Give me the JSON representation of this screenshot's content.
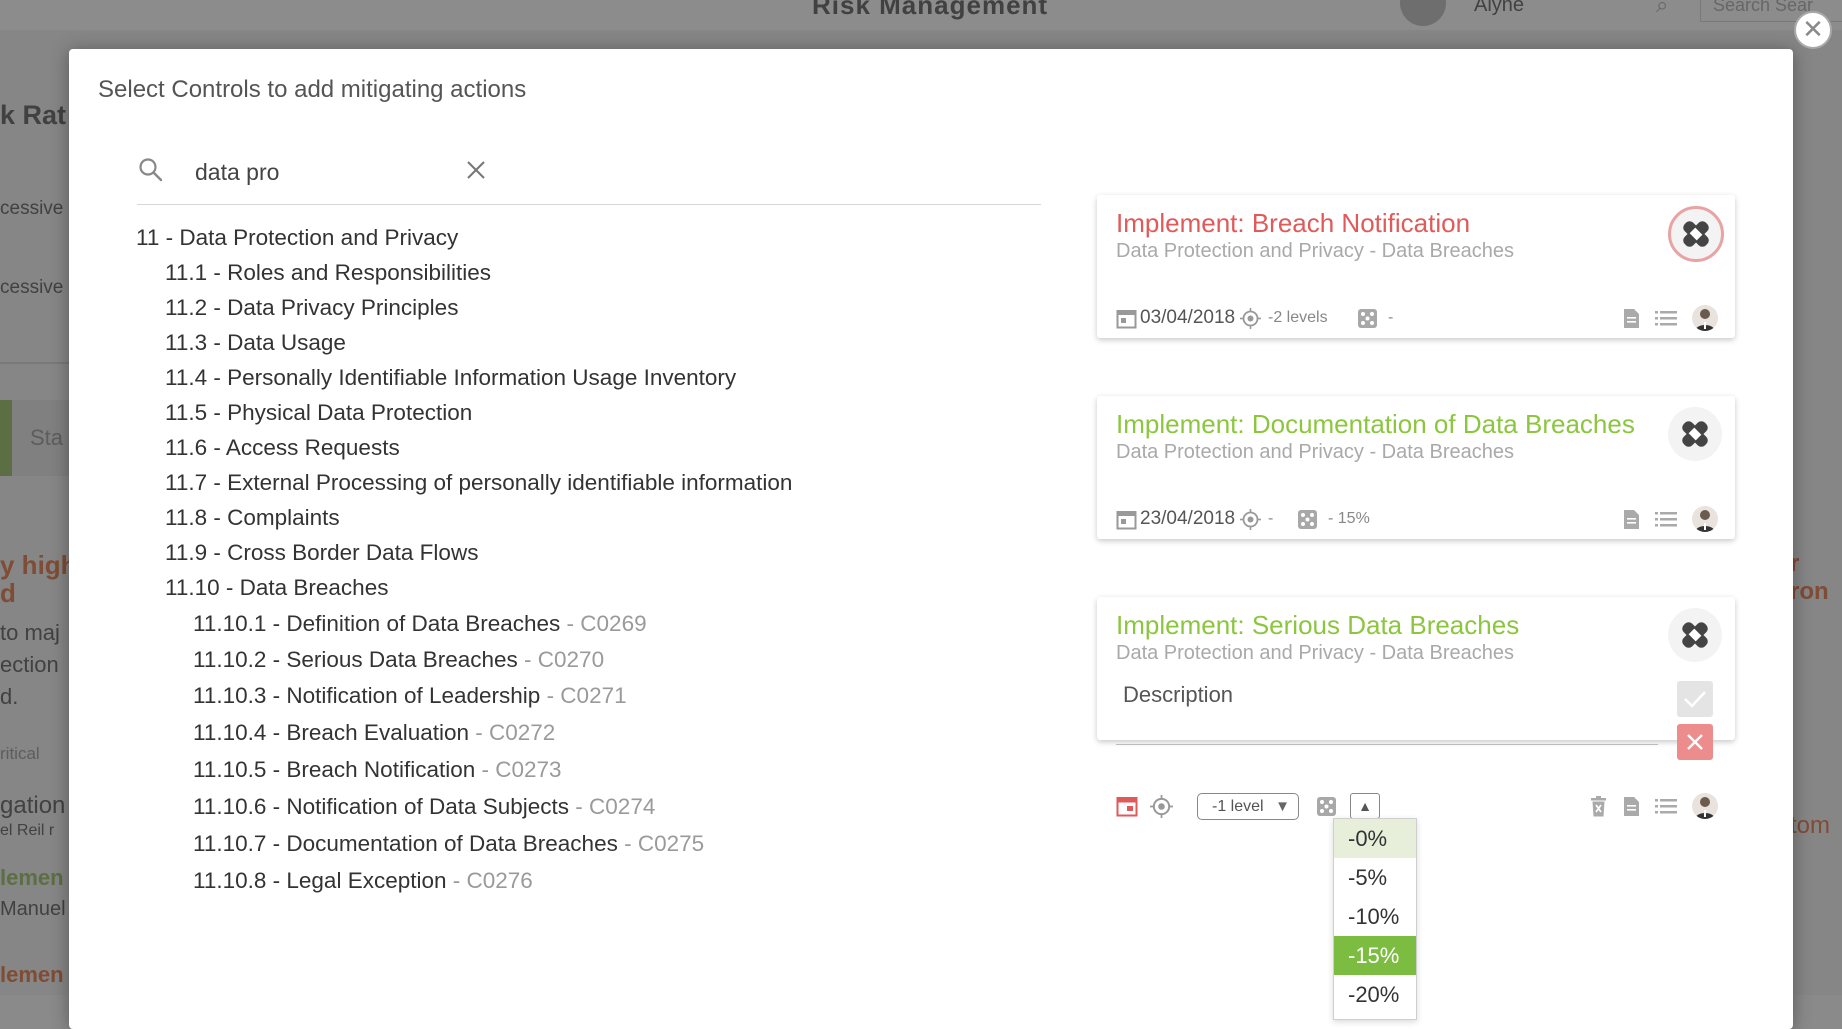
{
  "background": {
    "app_title": "Risk Management",
    "user_name": "Alyne",
    "search_placeholder": "Search Sear",
    "left_texts": [
      "k Rat",
      "cessive",
      "cessive",
      "Sta",
      "y high",
      "d",
      "to maj",
      "ection",
      "d.",
      "ritical",
      "gation",
      "el Reil r",
      "lemen",
      "Manuel",
      "lemen"
    ],
    "right_texts": [
      "r",
      "ron",
      "tom"
    ]
  },
  "modal": {
    "title": "Select Controls to add mitigating actions",
    "search": {
      "value": "data pro"
    },
    "tree": [
      {
        "label": "11 - Data Protection and Privacy",
        "code": ""
      },
      {
        "label": "11.1 - Roles and Responsibilities",
        "code": ""
      },
      {
        "label": "11.2 - Data Privacy Principles",
        "code": ""
      },
      {
        "label": "11.3 - Data Usage",
        "code": ""
      },
      {
        "label": "11.4 - Personally Identifiable Information Usage Inventory",
        "code": ""
      },
      {
        "label": "11.5 - Physical Data Protection",
        "code": ""
      },
      {
        "label": "11.6 - Access Requests",
        "code": ""
      },
      {
        "label": "11.7 - External Processing of personally identifiable information",
        "code": ""
      },
      {
        "label": "11.8 - Complaints",
        "code": ""
      },
      {
        "label": "11.9 - Cross Border Data Flows",
        "code": ""
      },
      {
        "label": "11.10 - Data Breaches",
        "code": ""
      },
      {
        "label": "11.10.1 - Definition of Data Breaches",
        "code": " - C0269"
      },
      {
        "label": "11.10.2 - Serious Data Breaches",
        "code": " - C0270"
      },
      {
        "label": "11.10.3 - Notification of Leadership",
        "code": " - C0271"
      },
      {
        "label": "11.10.4 - Breach Evaluation",
        "code": " - C0272"
      },
      {
        "label": "11.10.5 - Breach Notification",
        "code": " - C0273"
      },
      {
        "label": "11.10.6 - Notification of Data Subjects",
        "code": " - C0274"
      },
      {
        "label": "11.10.7 - Documentation of Data Breaches",
        "code": " - C0275"
      },
      {
        "label": "11.10.8 - Legal Exception",
        "code": " - C0276"
      }
    ],
    "cards": [
      {
        "title": "Implement: Breach Notification",
        "subtitle": "Data Protection and Privacy - Data Breaches",
        "date": "03/04/2018",
        "target": "-2 levels",
        "impact": "-"
      },
      {
        "title": "Implement: Documentation of Data Breaches",
        "subtitle": "Data Protection and Privacy - Data Breaches",
        "date": "23/04/2018",
        "target": "-",
        "impact": "- 15%"
      },
      {
        "title": "Implement: Serious Data Breaches",
        "subtitle": "Data Protection and Privacy - Data Breaches",
        "description_placeholder": "Description",
        "level": "-1 level"
      }
    ],
    "percent_dropdown": {
      "options": [
        "-0%",
        "-5%",
        "-10%",
        "-15%",
        "-20%"
      ],
      "selected": "-15%"
    }
  },
  "colors": {
    "red_title": "#e05a5a",
    "green_title": "#8cc63f",
    "selected_option": "#7cbd41",
    "cancel_button": "#ec8c8c"
  }
}
